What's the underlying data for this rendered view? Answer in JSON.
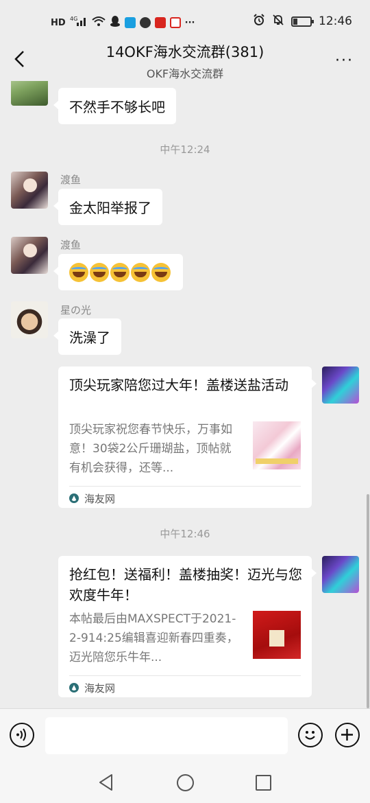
{
  "status_bar": {
    "left_icons": [
      "hd-icon",
      "signal-4g-icon",
      "wifi-icon",
      "qq-icon",
      "bulb-app-icon",
      "bird-app-icon",
      "news-app-icon",
      "red-app-icon"
    ],
    "hd_label": "HD",
    "network_label": "4G",
    "more_label": "···",
    "right_icons": [
      "alarm-icon",
      "mute-icon",
      "battery-icon"
    ],
    "battery_level": 0.22,
    "time": "12:46"
  },
  "header": {
    "title": "14OKF海水交流群(381)",
    "subtitle": "OKF海水交流群",
    "more_label": "···"
  },
  "messages": [
    {
      "sender": "",
      "text": "不然手不够长吧",
      "avatar": "avatar-green"
    },
    {
      "timestamp": "中午12:24"
    },
    {
      "sender": "渡鱼",
      "text": "金太阳举报了",
      "avatar": "avatar-anime"
    },
    {
      "sender": "渡鱼",
      "emoji": "crying-laughing-emoji",
      "emoji_count": 5,
      "avatar": "avatar-anime"
    },
    {
      "sender": "星の光",
      "text": "洗澡了",
      "avatar": "avatar-man"
    },
    {
      "type": "link_card",
      "title": "顶尖玩家陪您过大年！盖楼送盐活动",
      "description": "顶尖玩家祝您春节快乐，万事如意！30袋2公斤珊瑚盐，顶帖就有机会获得，还等...",
      "source": "海友网"
    },
    {
      "timestamp": "中午12:46"
    },
    {
      "type": "link_card",
      "title": "抢红包！送福利！盖楼抽奖！迈光与您欢度牛年！",
      "description": "本帖最后由MAXSPECT于2021-2-914:25编辑喜迎新春四重奏，迈光陪您乐牛年...",
      "source": "海友网"
    }
  ],
  "input_bar": {
    "voice_icon": "voice-icon",
    "emoji_icon": "smiley-icon",
    "plus_icon": "plus-icon",
    "input_value": ""
  },
  "nav_bar": {
    "icons": [
      "back-triangle-icon",
      "home-circle-icon",
      "recent-square-icon"
    ]
  }
}
